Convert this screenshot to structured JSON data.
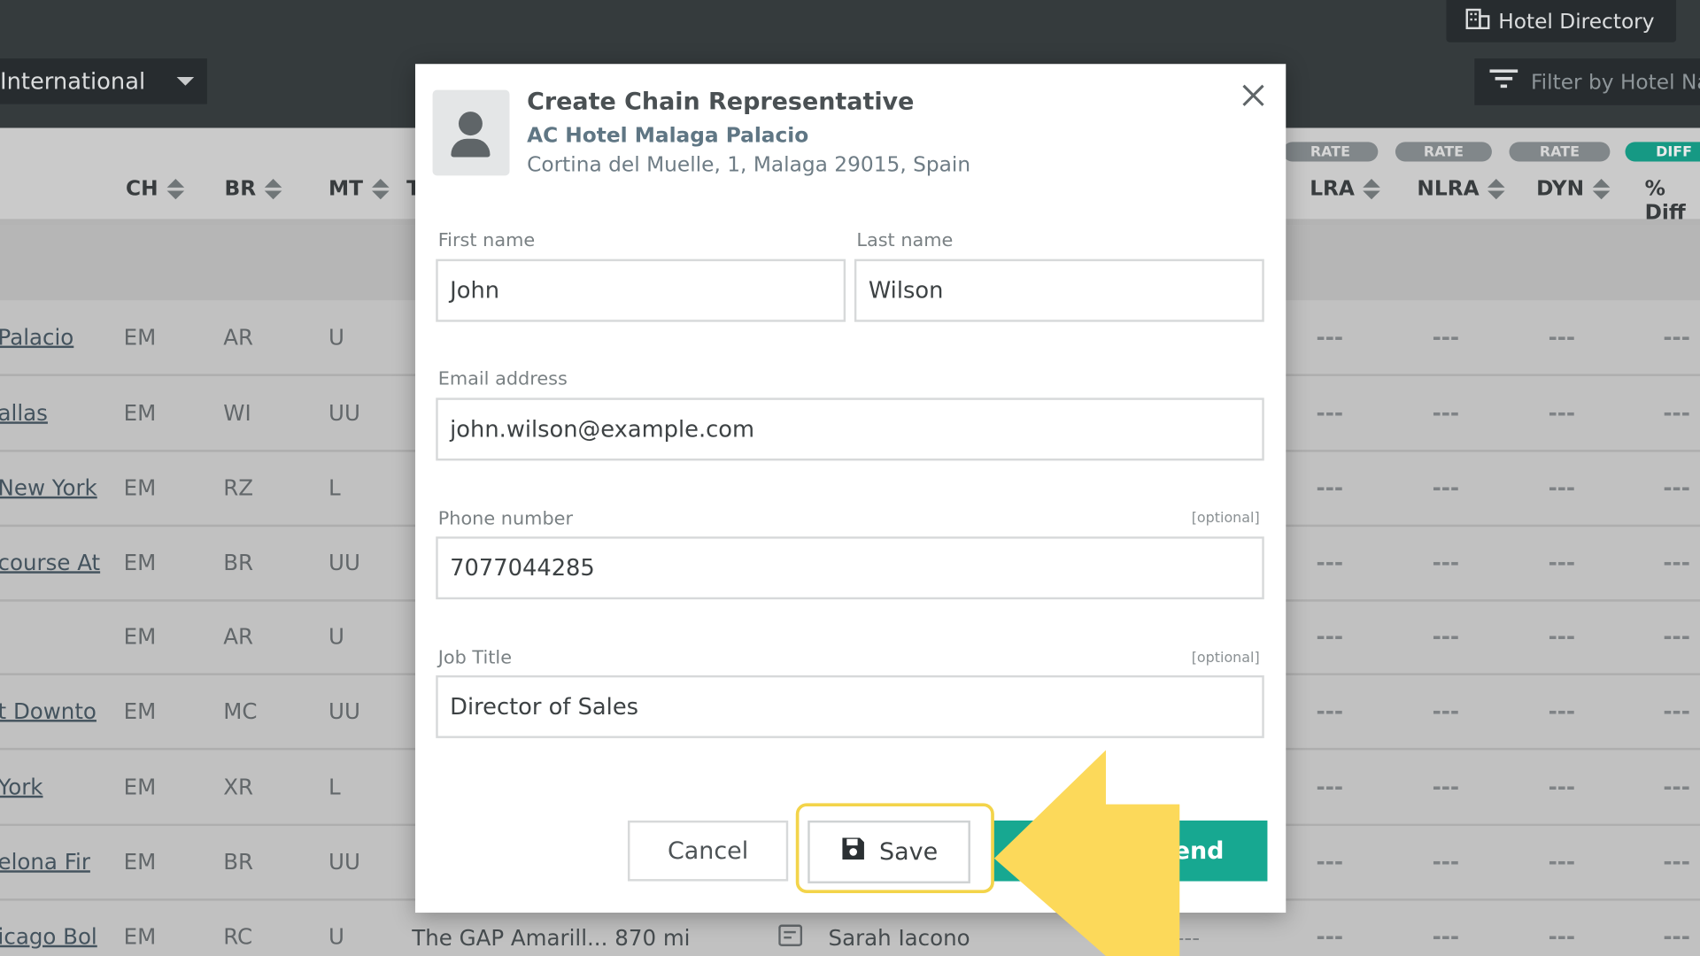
{
  "topbar": {
    "region": "International",
    "hotel_directory": "Hotel Directory",
    "filter_placeholder": "Filter by Hotel Na"
  },
  "table": {
    "headers": [
      {
        "label": "CH"
      },
      {
        "label": "BR"
      },
      {
        "label": "MT"
      },
      {
        "label": "T"
      },
      {
        "label": "LRA"
      },
      {
        "label": "NLRA"
      },
      {
        "label": "DYN"
      },
      {
        "label": "% Diff"
      }
    ],
    "pills": [
      "RATE",
      "RATE",
      "RATE",
      "DIFF"
    ],
    "rows": [
      {
        "name": "Palacio",
        "ch": "EM",
        "br": "AR",
        "mt": "U",
        "lra": "---",
        "nlra": "---",
        "dyn": "---",
        "diff": "---"
      },
      {
        "name": "allas",
        "ch": "EM",
        "br": "WI",
        "mt": "UU",
        "lra": "---",
        "nlra": "---",
        "dyn": "---",
        "diff": "---"
      },
      {
        "name": "New York",
        "ch": "EM",
        "br": "RZ",
        "mt": "L",
        "lra": "---",
        "nlra": "---",
        "dyn": "---",
        "diff": "---"
      },
      {
        "name": "course At",
        "ch": "EM",
        "br": "BR",
        "mt": "UU",
        "lra": "---",
        "nlra": "---",
        "dyn": "---",
        "diff": "---"
      },
      {
        "name": "",
        "ch": "EM",
        "br": "AR",
        "mt": "U",
        "lra": "---",
        "nlra": "---",
        "dyn": "---",
        "diff": "---"
      },
      {
        "name": "t Downto",
        "ch": "EM",
        "br": "MC",
        "mt": "UU",
        "lra": "---",
        "nlra": "---",
        "dyn": "---",
        "diff": "---"
      },
      {
        "name": "York",
        "ch": "EM",
        "br": "XR",
        "mt": "L",
        "lra": "---",
        "nlra": "---",
        "dyn": "---",
        "diff": "---"
      },
      {
        "name": "elona Fir",
        "ch": "EM",
        "br": "BR",
        "mt": "UU",
        "lra": "---",
        "nlra": "---",
        "dyn": "---",
        "diff": "---"
      },
      {
        "name": "icago Bol",
        "ch": "EM",
        "br": "RC",
        "mt": "U",
        "lra": "---",
        "nlra": "---",
        "dyn": "---",
        "diff": "---"
      }
    ],
    "last_row_extra": {
      "hotel": "The GAP Amarill...",
      "distance": "870 mi",
      "rep": "Sarah Iacono",
      "dash": "---"
    }
  },
  "modal": {
    "title": "Create Chain Representative",
    "hotel_name": "AC Hotel Malaga Palacio",
    "address": "Cortina del Muelle, 1, Malaga 29015, Spain",
    "first_name_label": "First name",
    "first_name_value": "John",
    "last_name_label": "Last name",
    "last_name_value": "Wilson",
    "email_label": "Email address",
    "email_value": "john.wilson@example.com",
    "phone_label": "Phone number",
    "phone_optional": "[optional]",
    "phone_value": "7077044285",
    "job_label": "Job Title",
    "job_optional": "[optional]",
    "job_value": "Director of Sales",
    "cancel_label": "Cancel",
    "save_label": "Save",
    "send_label": "end"
  },
  "colors": {
    "accent": "#17a891",
    "highlight": "#f3d44a",
    "arrow": "#fcd95a",
    "topbar": "#3a4043"
  },
  "icons": [
    "building-icon",
    "filter-icon",
    "sort-icon",
    "person-icon",
    "close-icon",
    "floppy-disk-icon",
    "note-icon",
    "arrow-icon"
  ]
}
